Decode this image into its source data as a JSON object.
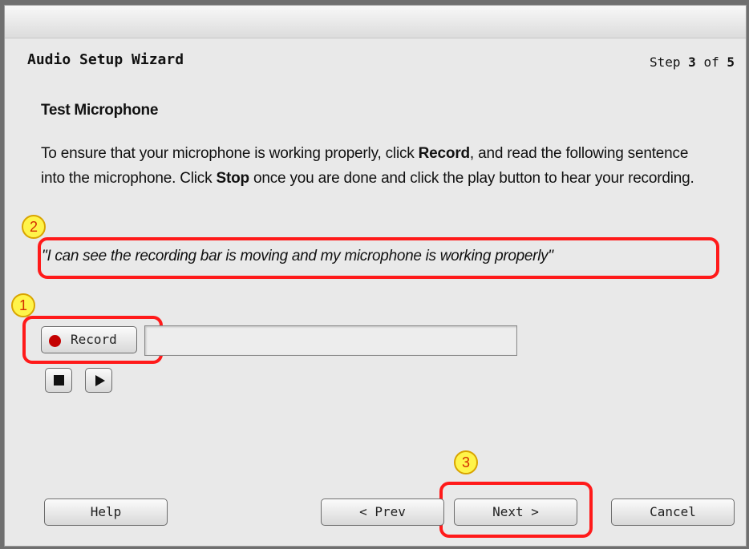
{
  "wizard": {
    "title": "Audio Setup Wizard",
    "step_prefix": "Step",
    "step_current": "3",
    "step_of": "of",
    "step_total": "5"
  },
  "section": {
    "title": "Test Microphone"
  },
  "instructions": {
    "part1": "To ensure that your microphone is working properly, click ",
    "record_word": "Record",
    "part2": ", and read the following sentence into the microphone. Click ",
    "stop_word": "Stop",
    "part3": " once you are done and click the play button to hear your recording."
  },
  "sentence": "\"I can see the recording bar is moving and my microphone is working properly\"",
  "controls": {
    "record_label": "Record",
    "record_icon": "record-dot-icon",
    "stop_icon": "stop-icon",
    "play_icon": "play-icon",
    "recording_level": 0
  },
  "footer": {
    "help_label": "Help",
    "prev_label": "< Prev",
    "next_label": "Next >",
    "cancel_label": "Cancel"
  },
  "callouts": [
    "1",
    "2",
    "3"
  ],
  "colors": {
    "callout_border": "#ff1a1a",
    "marker_fill": "#fff44a",
    "record_dot": "#c40000"
  }
}
